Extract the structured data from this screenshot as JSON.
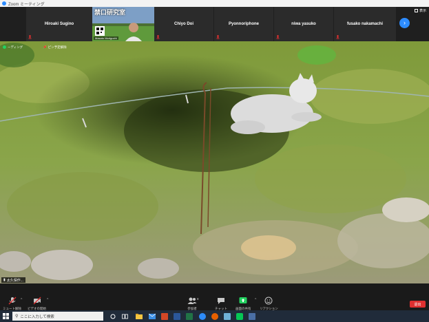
{
  "window": {
    "title": "Zoom ミーティング"
  },
  "participants": [
    {
      "name": "Hiroaki Sugino"
    },
    {
      "name": "Chiyo Doi"
    },
    {
      "name": "Pyonnoriphone"
    },
    {
      "name": "niwa yasuko"
    },
    {
      "name": "fusako nakamachi"
    }
  ],
  "video_tile": {
    "overlay_text": "禁口研究室",
    "label": "Masato Moriguchi"
  },
  "strip": {
    "view_label": "表示",
    "next_label": "›"
  },
  "main": {
    "status_left": "ーディング",
    "status_right": "ピン予定解除",
    "speaker_tag": "太久保作..."
  },
  "toolbar": {
    "mute": "ミュート解除",
    "video": "ビデオの開始",
    "participants": "参加者",
    "participants_count": "8",
    "chat": "チャット",
    "share": "画面の共有",
    "reactions": "リアクション",
    "end": "退出"
  },
  "taskbar": {
    "search_placeholder": "ここに入力して検索"
  },
  "colors": {
    "accent": "#2d8cff",
    "share_green": "#23d160",
    "end_red": "#e02f2f",
    "taskbar": "#202b3a"
  }
}
